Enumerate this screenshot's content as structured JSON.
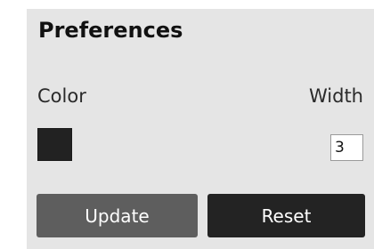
{
  "preferences": {
    "title": "Preferences",
    "color_label": "Color",
    "width_label": "Width",
    "color_value": "#222222",
    "width_value": "3",
    "update_label": "Update",
    "reset_label": "Reset"
  }
}
